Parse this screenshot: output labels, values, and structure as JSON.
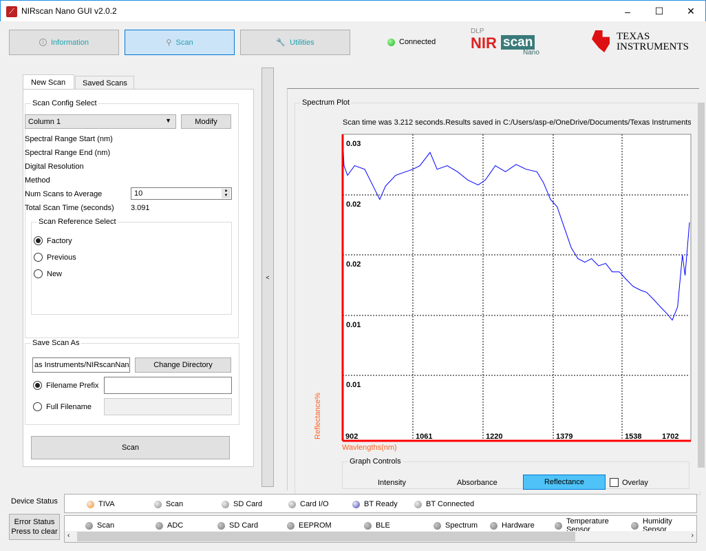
{
  "window": {
    "title": "NIRscan Nano GUI v2.0.2",
    "minimize": "–",
    "maximize": "☐",
    "close": "✕"
  },
  "nav": {
    "information": "Information",
    "scan": "Scan",
    "utilities": "Utilities",
    "connection_status": "Connected",
    "connection_color": "#22c55e"
  },
  "logos": {
    "dlp": "DLP",
    "nir": "NIR",
    "scan": "scan",
    "nano": "Nano",
    "ti_line1": "Texas",
    "ti_line2": "Instruments"
  },
  "tabs": {
    "new_scan": "New Scan",
    "saved_scans": "Saved Scans"
  },
  "scan_config": {
    "legend": "Scan Config Select",
    "selected": "Column 1",
    "modify": "Modify",
    "spectral_start": "Spectral Range Start (nm)",
    "spectral_end": "Spectral Range End (nm)",
    "digital_resolution": "Digital Resolution",
    "method": "Method",
    "num_scans_label": "Num Scans to Average",
    "num_scans_value": "10",
    "total_time_label": "Total Scan Time (seconds)",
    "total_time_value": "3.091"
  },
  "reference": {
    "legend": "Scan Reference Select",
    "options": [
      "Factory",
      "Previous",
      "New"
    ],
    "selected": "Factory"
  },
  "save": {
    "legend": "Save Scan As",
    "directory": "as Instruments/NIRscanNano",
    "change_dir": "Change Directory",
    "prefix_label": "Filename Prefix",
    "prefix_value": "",
    "full_label": "Full Filename",
    "full_value": ""
  },
  "scan_button": "Scan",
  "collapse": "<",
  "plot": {
    "legend": "Spectrum Plot",
    "message": "Scan time was 3.212 seconds.Results saved in C:/Users/asp-e/OneDrive/Documents/Texas Instruments/"
  },
  "chart_data": {
    "type": "line",
    "xlabel": "Wavlengths(nm)",
    "ylabel": "Reflectance%",
    "x_tick_labels": [
      "902",
      "1061",
      "1220",
      "1379",
      "1538",
      "1702"
    ],
    "y_tick_labels": [
      "0.03",
      "0.02",
      "0.02",
      "0.01",
      "0.01"
    ],
    "xlim": [
      902,
      1688
    ],
    "ylim": [
      0.0046,
      0.03
    ],
    "grid": true,
    "line_color": "#0000ff",
    "axis_color": "#ff0000",
    "x": [
      902,
      905,
      913,
      929,
      952,
      967,
      986,
      999,
      1022,
      1045,
      1061,
      1077,
      1100,
      1116,
      1139,
      1162,
      1186,
      1209,
      1225,
      1248,
      1271,
      1295,
      1318,
      1342,
      1357,
      1373,
      1388,
      1404,
      1420,
      1435,
      1451,
      1466,
      1482,
      1498,
      1513,
      1529,
      1544,
      1560,
      1576,
      1591,
      1607,
      1622,
      1638,
      1649,
      1661,
      1672,
      1678,
      1688
    ],
    "y": [
      0.03,
      0.0274,
      0.0266,
      0.0274,
      0.0271,
      0.026,
      0.0246,
      0.0257,
      0.0266,
      0.0269,
      0.0271,
      0.0274,
      0.0285,
      0.0271,
      0.0274,
      0.0269,
      0.0262,
      0.0258,
      0.0262,
      0.0274,
      0.0269,
      0.0275,
      0.0271,
      0.0269,
      0.026,
      0.0246,
      0.024,
      0.0223,
      0.0206,
      0.0197,
      0.0194,
      0.0197,
      0.0191,
      0.0193,
      0.0186,
      0.0186,
      0.018,
      0.0174,
      0.0171,
      0.0169,
      0.0163,
      0.0157,
      0.0151,
      0.0146,
      0.0157,
      0.02,
      0.0183,
      0.0227
    ]
  },
  "graph_controls": {
    "legend": "Graph Controls",
    "intensity": "Intensity",
    "absorbance": "Absorbance",
    "reflectance": "Reflectance",
    "overlay": "Overlay",
    "active": "Reflectance"
  },
  "device_status": {
    "label": "Device Status",
    "items": [
      {
        "label": "TIVA",
        "color": "#ff8c1a"
      },
      {
        "label": "Scan",
        "color": "#8a8a8a"
      },
      {
        "label": "SD Card",
        "color": "#8a8a8a"
      },
      {
        "label": "Card I/O",
        "color": "#8a8a8a"
      },
      {
        "label": "BT Ready",
        "color": "#4040c0"
      },
      {
        "label": "BT Connected",
        "color": "#8a8a8a"
      }
    ]
  },
  "error_status": {
    "label_line1": "Error Status",
    "label_line2": "Press to clear",
    "items": [
      {
        "label": "Scan"
      },
      {
        "label": "ADC"
      },
      {
        "label": "SD Card"
      },
      {
        "label": "EEPROM"
      },
      {
        "label": "BLE"
      },
      {
        "label": "Spectrum"
      },
      {
        "label": "Hardware"
      },
      {
        "label": "Temperature Sensor"
      },
      {
        "label": "Humidity Sensor"
      }
    ]
  }
}
